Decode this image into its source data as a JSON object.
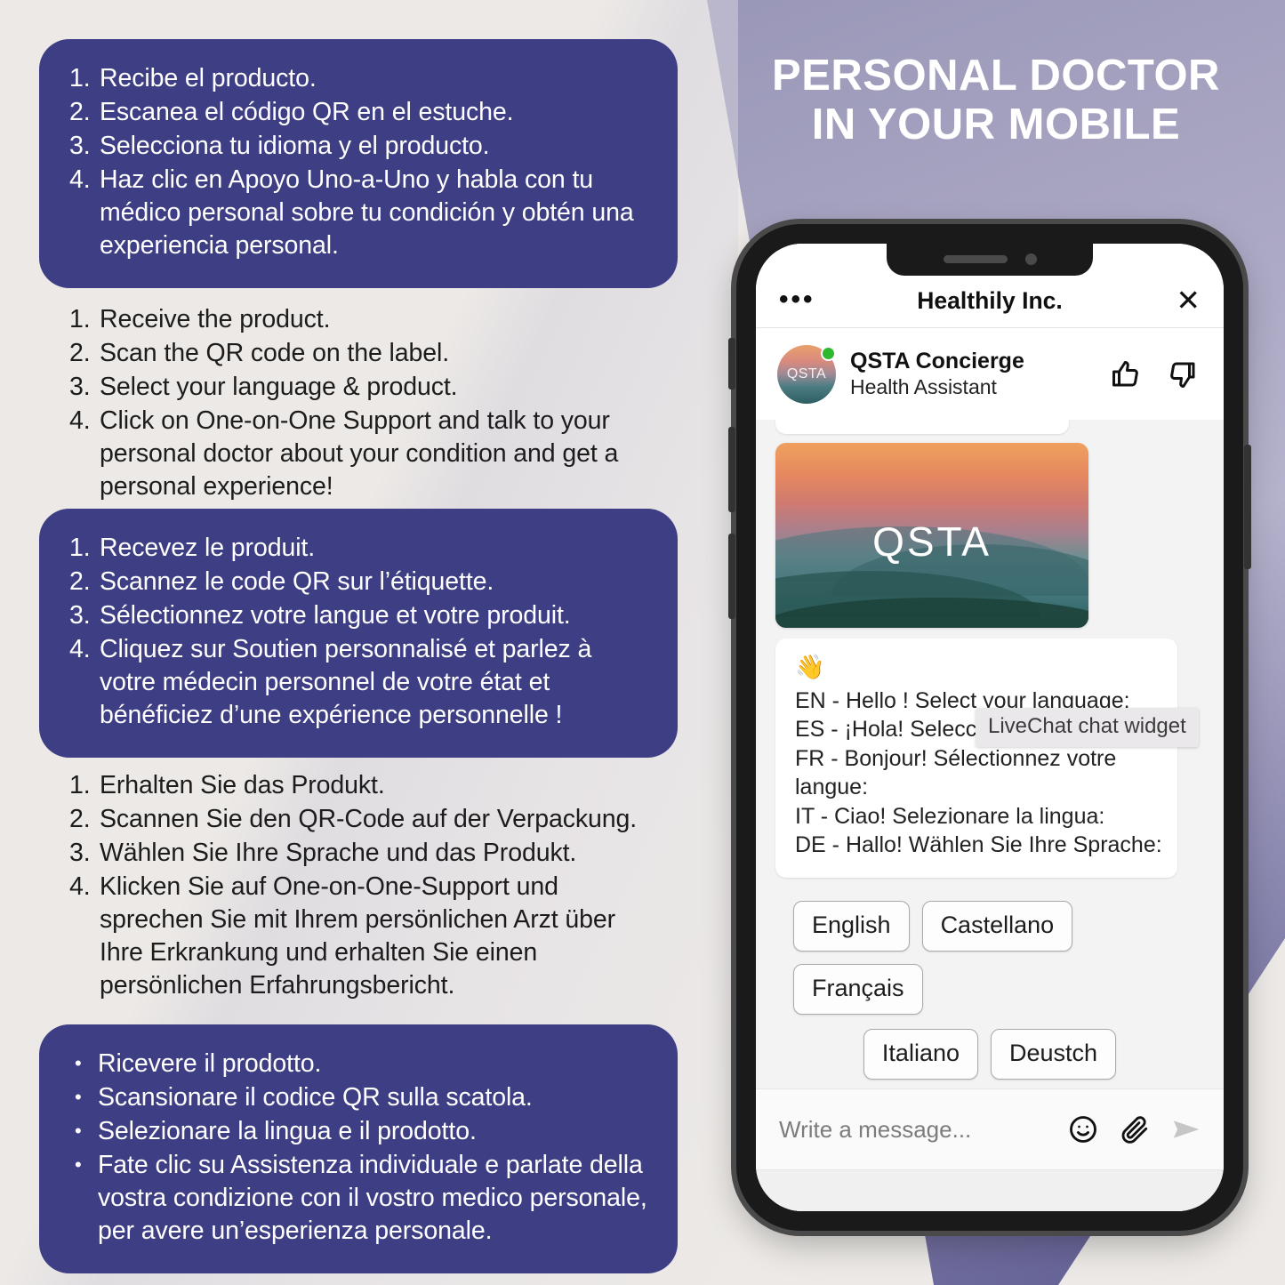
{
  "headline": {
    "line1": "PERSONAL DOCTOR",
    "line2": "IN YOUR MOBILE"
  },
  "colors": {
    "brand_purple": "#3e3e84",
    "background_cream": "#ece9e6",
    "online_green": "#2eb82e"
  },
  "instructions": {
    "spanish": {
      "list_type": "ordered",
      "items": [
        "Recibe el producto.",
        "Escanea el código QR en el estuche.",
        "Selecciona tu idioma y el producto.",
        "Haz clic en Apoyo Uno-a-Uno y habla con tu médico personal sobre tu condición y obtén una experiencia personal."
      ]
    },
    "english": {
      "list_type": "ordered",
      "items": [
        "Receive the product.",
        "Scan the QR code on the label.",
        "Select your language & product.",
        "Click on One-on-One Support and talk to your personal doctor about your condition and get a personal experience!"
      ]
    },
    "french": {
      "list_type": "ordered",
      "items": [
        "Recevez le produit.",
        "Scannez le code QR sur l’étiquette.",
        "Sélectionnez votre langue et votre produit.",
        "Cliquez sur Soutien personnalisé et parlez à votre médecin personnel de votre état et bénéficiez d’une expérience personnelle !"
      ]
    },
    "german": {
      "list_type": "ordered",
      "items": [
        "Erhalten Sie das Produkt.",
        "Scannen Sie den QR-Code auf der Verpackung.",
        "Wählen Sie Ihre Sprache und das Produkt.",
        "Klicken Sie auf One-on-One-Support und sprechen Sie mit Ihrem persönlichen Arzt über Ihre Erkrankung und erhalten Sie einen persönlichen Erfahrungsbericht."
      ]
    },
    "italian": {
      "list_type": "bulleted",
      "items": [
        "Ricevere il prodotto.",
        "Scansionare il codice QR sulla scatola.",
        "Selezionare la lingua e il prodotto.",
        "Fate clic su Assistenza individuale e parlate della vostra condizione con il vostro medico personale, per avere un’esperienza personale."
      ]
    }
  },
  "phone": {
    "chat": {
      "topbar": {
        "menu_icon": "ellipsis-icon",
        "title": "Healthily Inc.",
        "close_icon": "close-icon"
      },
      "agent": {
        "avatar_label": "QSTA",
        "name": "QSTA Concierge",
        "role": "Health Assistant",
        "thumbs_up_icon": "thumbs-up-icon",
        "thumbs_down_icon": "thumbs-down-icon",
        "status": "online"
      },
      "card": {
        "label": "QSTA"
      },
      "greeting": {
        "emoji": "👋",
        "lines": [
          "EN - Hello ! Select your language:",
          "ES - ¡Hola! Selecciona tu idioma:",
          "FR - Bonjour! Sélectionnez votre langue:",
          "IT - Ciao! Selezionare la lingua:",
          "DE - Hallo! Wählen Sie Ihre Sprache:"
        ]
      },
      "tooltip": "LiveChat chat widget",
      "language_chips_row1": [
        "English",
        "Castellano",
        "Français"
      ],
      "language_chips_row2": [
        "Italiano",
        "Deustch"
      ],
      "composer": {
        "placeholder": "Write a message...",
        "emoji_icon": "smiley-icon",
        "attach_icon": "paperclip-icon",
        "send_icon": "send-icon"
      }
    }
  }
}
